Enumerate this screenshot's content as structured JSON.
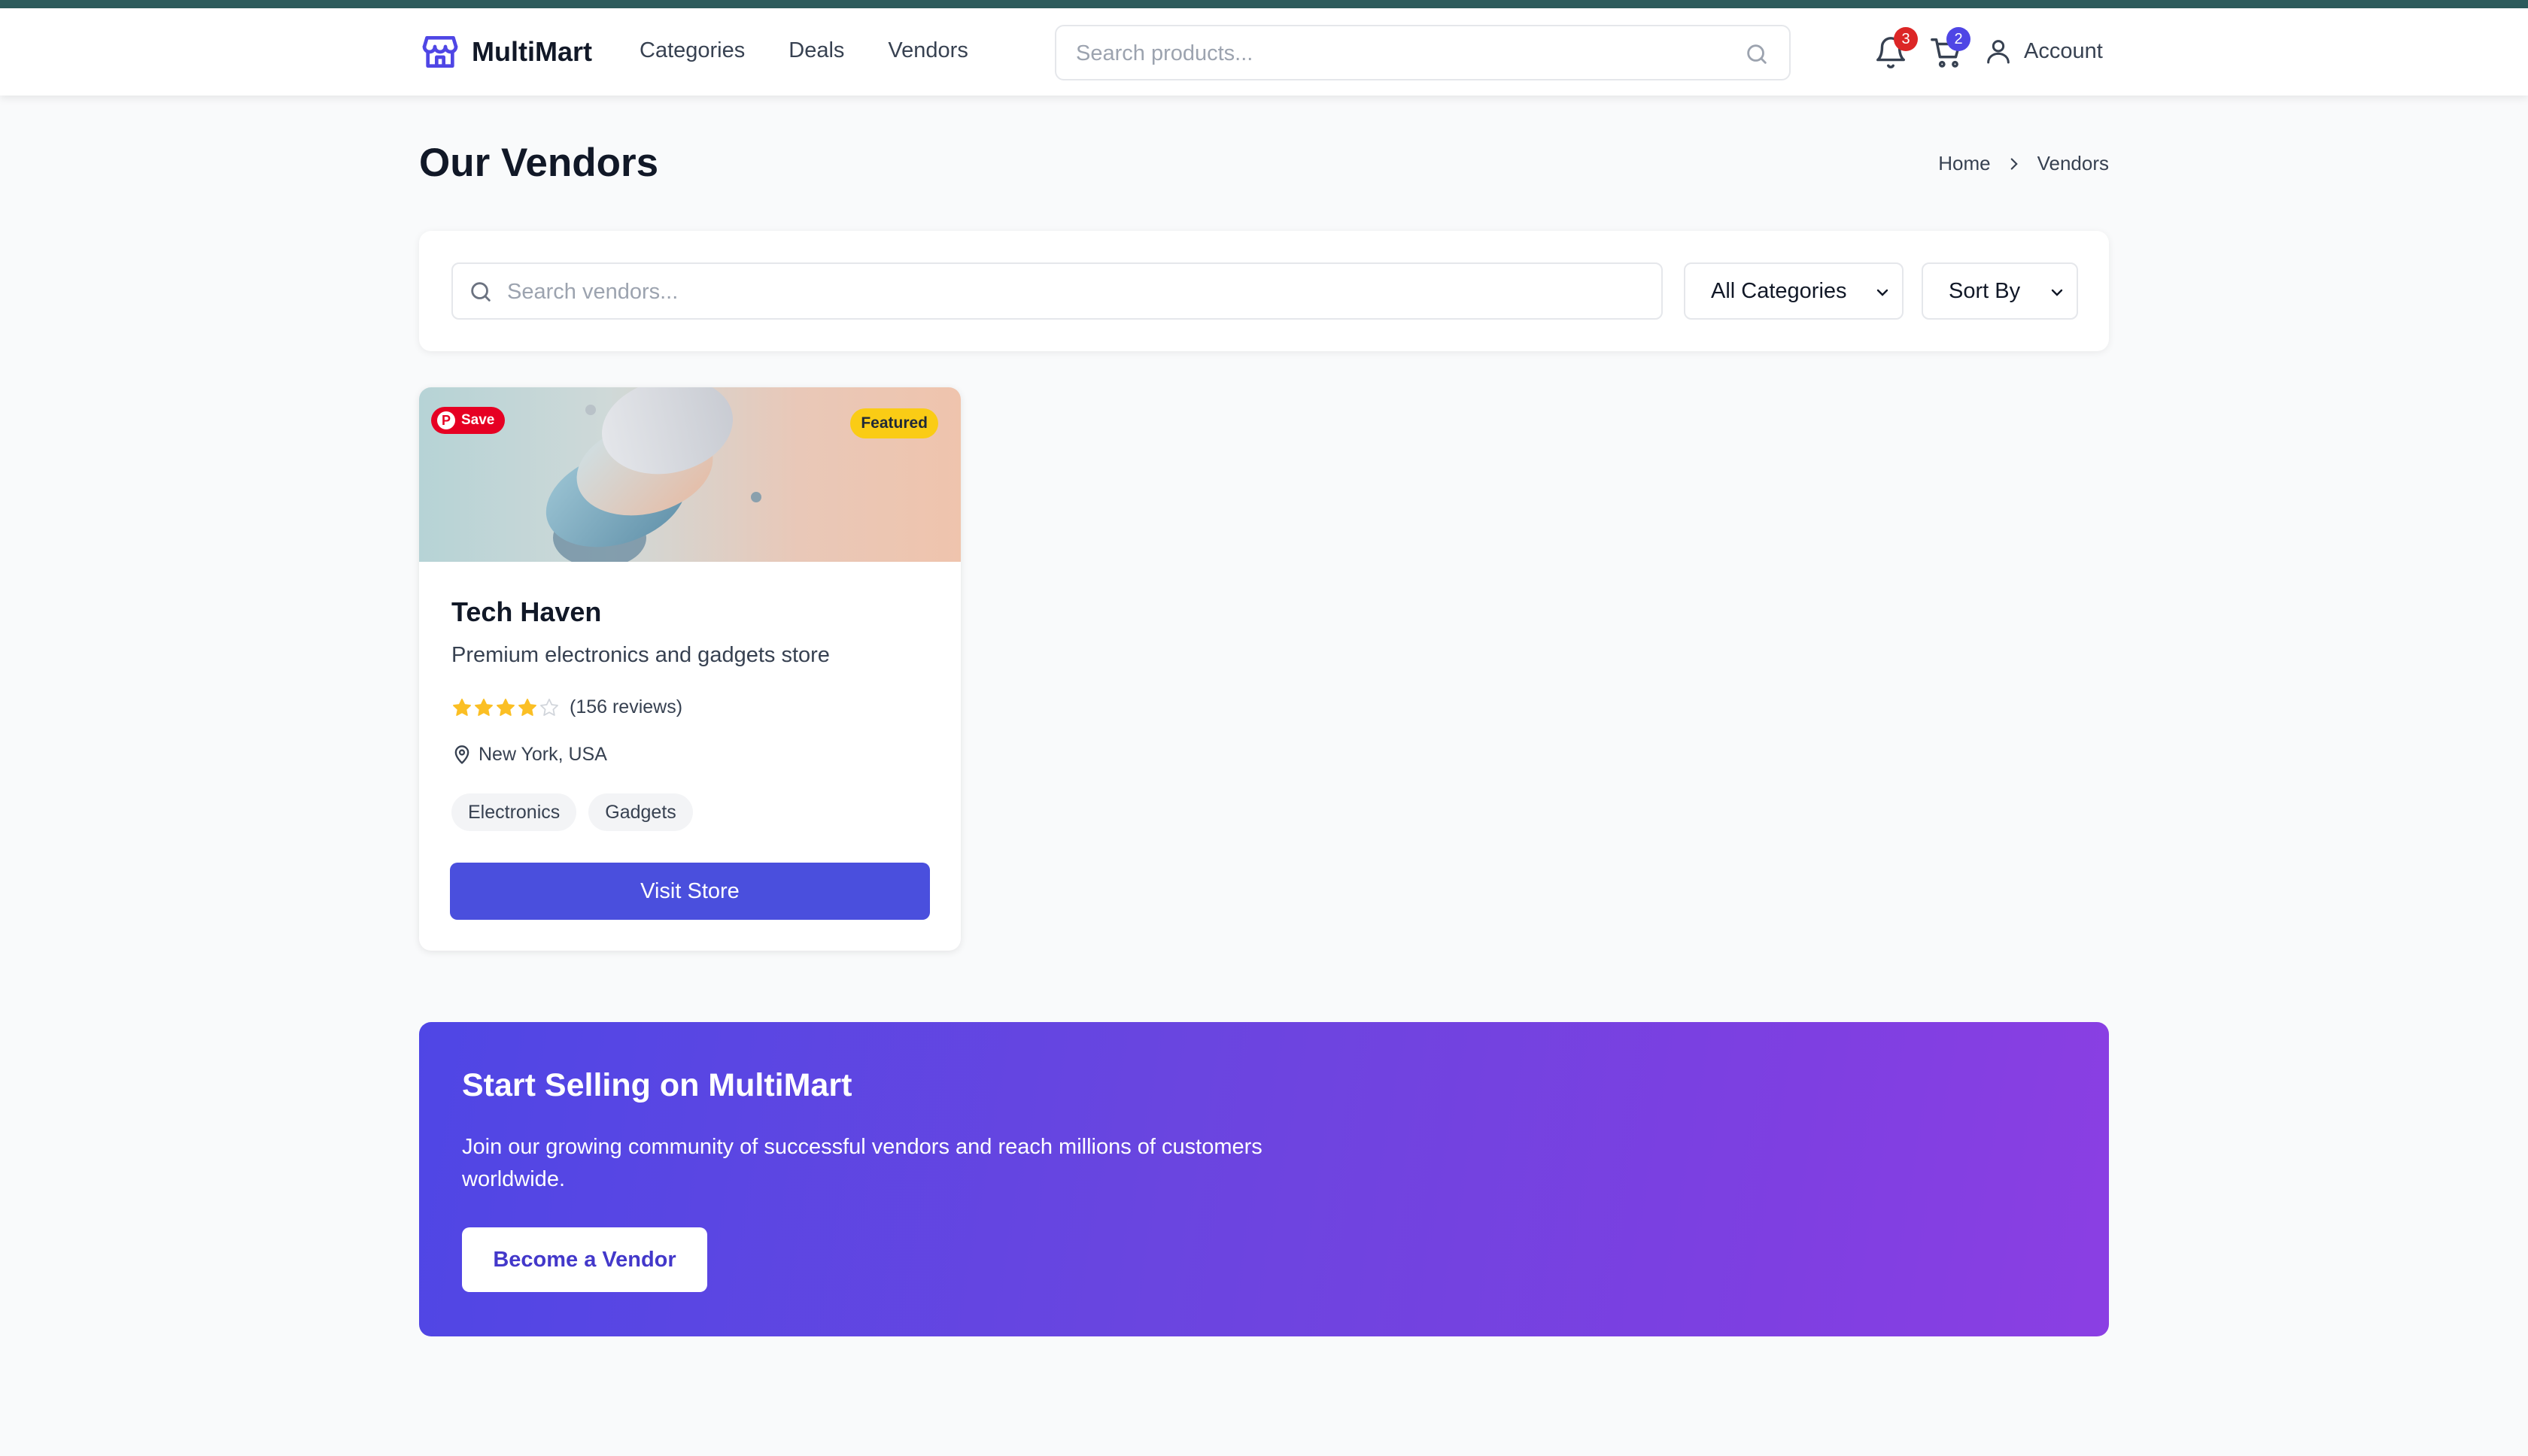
{
  "colors": {
    "top_strip": "#2d5b5c",
    "brand": "#4a4fdd",
    "badge_red": "#dc2626",
    "badge_blue": "#4f46e5",
    "featured": "#facc15",
    "star": "#fbbf24"
  },
  "header": {
    "logo_icon": "storefront-icon",
    "brand": "MultiMart",
    "nav": [
      "Categories",
      "Deals",
      "Vendors"
    ],
    "search_placeholder": "Search products...",
    "notifications_count": "3",
    "cart_count": "2",
    "account_label": "Account"
  },
  "page": {
    "title": "Our Vendors",
    "breadcrumb": [
      "Home",
      "Vendors"
    ]
  },
  "filters": {
    "search_placeholder": "Search vendors...",
    "category_selected": "All Categories",
    "sort_selected": "Sort By"
  },
  "vendors": [
    {
      "save_label": "Save",
      "featured_label": "Featured",
      "name": "Tech Haven",
      "description": "Premium electronics and gadgets store",
      "rating": 4,
      "rating_max": 5,
      "reviews_text": "(156 reviews)",
      "location": "New York, USA",
      "tags": [
        "Electronics",
        "Gadgets"
      ],
      "button_label": "Visit Store"
    }
  ],
  "cta": {
    "title": "Start Selling on MultiMart",
    "text": "Join our growing community of successful vendors and reach millions of customers worldwide.",
    "button_label": "Become a Vendor"
  }
}
